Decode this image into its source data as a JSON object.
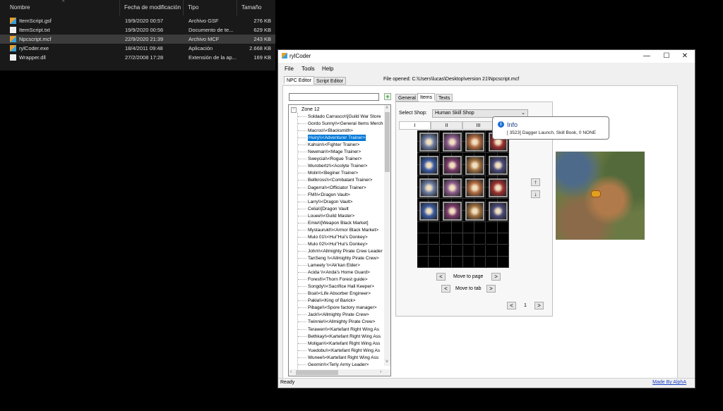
{
  "explorer": {
    "columns": [
      "Nombre",
      "Fecha de modificación",
      "Tipo",
      "Tamaño"
    ],
    "files": [
      {
        "name": "ItemScript.gsf",
        "date": "19/9/2020 00:57",
        "type": "Archivo GSF",
        "size": "276 KB",
        "icon": "app-icon"
      },
      {
        "name": "ItemScript.txt",
        "date": "19/9/2020 00:56",
        "type": "Documento de te...",
        "size": "629 KB",
        "icon": "text-file-icon"
      },
      {
        "name": "Npcscript.mcf",
        "date": "22/9/2020 21:39",
        "type": "Archivo MCF",
        "size": "243 KB",
        "icon": "app-icon"
      },
      {
        "name": "rylCoder.exe",
        "date": "18/4/2011 09:48",
        "type": "Aplicación",
        "size": "2.668 KB",
        "icon": "app-icon"
      },
      {
        "name": "Wrapper.dll",
        "date": "27/2/2008 17:28",
        "type": "Extensión de la ap...",
        "size": "169 KB",
        "icon": "dll-file-icon"
      }
    ]
  },
  "window": {
    "title": "rylCoder",
    "minimize": "—",
    "maximize": "☐",
    "close": "✕"
  },
  "menu": [
    "File",
    "Tools",
    "Help"
  ],
  "editor_tabs": [
    "NPC Editor",
    "Script Editor"
  ],
  "file_opened": "File opened: C:\\Users\\lucas\\Desktop\\version 21\\Npcscript.mcf",
  "npc_tree": {
    "root": "Zone 12",
    "items": [
      "Soldado Carrasco\\\\[Guild War Store",
      "Gordo Sunny\\\\<General Items Merch",
      "Macros\\\\<Blacksmith>",
      "Huiry\\\\<Adventurer Trainer>",
      "Kahsin\\\\<Fighter Trainer>",
      "Newman\\\\<Mage Trainer>",
      "Sweycia\\\\<Rogue Trainer>",
      "Wurobertz\\\\<Acolyte Trainer>",
      "Molin\\\\<Beginer Trainer>",
      "Bellkross\\\\<Combatant Trainer>",
      "Dagerra\\\\<Officiator Trainer>",
      "FMI\\\\<Dragon Vault>",
      "Larry\\\\<Dragon Vault>",
      "Celia\\\\[Dragon Vault",
      "Louee\\\\<Guild Master>",
      "Emie\\\\[Weapon Black Market]",
      "Mystaurukt\\\\<Armor Black Market>",
      "Mulo 01\\\\<Hui''Hui's Donkey>",
      "Mulo 02\\\\<Hui''Hui's Donkey>",
      "John\\\\<Allmighty Pirate Crew Leader",
      "TanSeng \\\\<Allmighty Pirate Crew>",
      "Lameely \\\\<Ak'kan Elder>",
      "Acida \\\\<Anda's Home Guard>",
      "Forest\\\\<Thorn Forest guide>",
      "Songdy\\\\<Sacrifice Hall Keeper>",
      "Boa\\\\<Life Absorber Engineer>",
      "Pakla\\\\<King of Barick>",
      "Pibage\\\\<Spore factory manager>",
      "Jack\\\\<Allmighty Pirate Crew>",
      "Twinnie\\\\<Allmighty Pirate Crew>",
      "Terawen\\\\<Kartefant Right Wing As",
      "Bethkay\\\\<Kartefant Right Wing Ass",
      "Moligan\\\\<Kartefant Right Wing Ass",
      "Yuedobu\\\\<Kartefant Right Wing As",
      "Wunee\\\\<Kartefant Right Wing Ass",
      "Geomin\\\\<Terly Army Leader>",
      "Mole...\\\\<Terly..."
    ],
    "selected_index": 3
  },
  "npc_tabs": [
    "General",
    "Items",
    "Texts"
  ],
  "shop": {
    "label": "Select Shop:",
    "value": "Human Skill Shop",
    "page_tabs": [
      "I",
      "II",
      "III"
    ]
  },
  "navigation": {
    "page_prev": "<",
    "page_next": ">",
    "move_to_page": "Move to page",
    "tab_prev": "<",
    "tab_next": ">",
    "move_to_tab": "Move to tab",
    "up": "↑",
    "down": "↓",
    "current_prev": "<",
    "current_page": "1",
    "current_next": ">"
  },
  "tooltip": {
    "title": "Info",
    "text": "[ 3523] Dagger Launch, Skill Book, 0 NONE"
  },
  "status": {
    "text": "Ready",
    "link": "Made By AlphA"
  },
  "colors": {
    "selection": "#0078d7",
    "link": "#1a40c8",
    "info_icon": "#1a6fd4"
  }
}
